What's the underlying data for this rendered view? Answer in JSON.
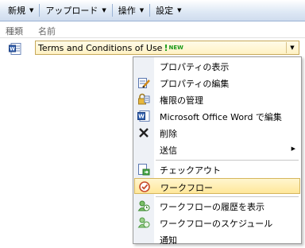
{
  "toolbar": {
    "new_label": "新規",
    "upload_label": "アップロード",
    "actions_label": "操作",
    "settings_label": "設定"
  },
  "list": {
    "col_type": "種類",
    "col_name": "名前",
    "item_title": "Terms and Conditions of Use",
    "new_mark": "!",
    "new_label": "NEW"
  },
  "menu": {
    "view_properties": "プロパティの表示",
    "edit_properties": "プロパティの編集",
    "manage_permissions": "権限の管理",
    "edit_in_word": "Microsoft Office Word で編集",
    "delete": "削除",
    "send_to": "送信",
    "check_out": "チェックアウト",
    "workflows": "ワークフロー",
    "workflow_history": "ワークフローの履歴を表示",
    "workflow_schedule": "ワークフローのスケジュール",
    "alert_me": "通知"
  },
  "colors": {
    "highlight": "#ffe79a",
    "new_green": "#1a9a1a",
    "toolbar_border": "#9bb3d4"
  }
}
